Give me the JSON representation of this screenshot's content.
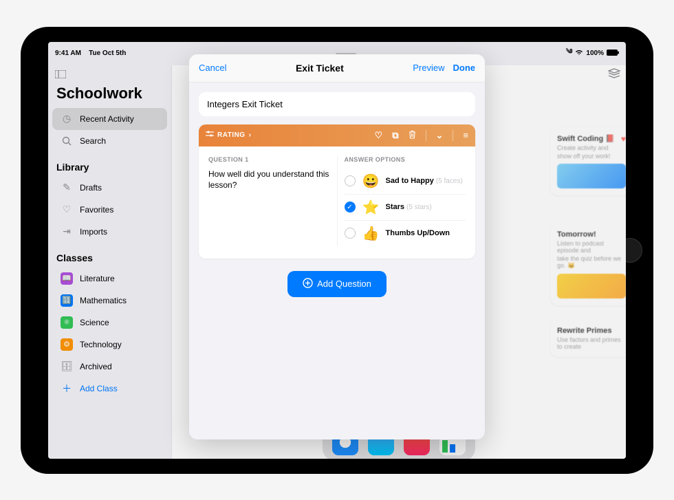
{
  "status": {
    "time": "9:41 AM",
    "date": "Tue Oct 5th",
    "battery": "100%"
  },
  "sidebar": {
    "appTitle": "Schoolwork",
    "recent": "Recent Activity",
    "search": "Search",
    "libraryHeader": "Library",
    "drafts": "Drafts",
    "favorites": "Favorites",
    "imports": "Imports",
    "classesHeader": "Classes",
    "literature": "Literature",
    "mathematics": "Mathematics",
    "science": "Science",
    "technology": "Technology",
    "archived": "Archived",
    "addClass": "Add Class"
  },
  "bgcards": {
    "c1title": "Swift Coding 📕",
    "c1sub1": "Create activity and",
    "c1sub2": "show off your work!",
    "c2title": "Tomorrow!",
    "c2sub1": "Listen to podcast episode and",
    "c2sub2": "take the quiz before we go. 🐱",
    "c3title": "Rewrite Primes",
    "c3sub": "Use factors and primes to create"
  },
  "modal": {
    "cancel": "Cancel",
    "title": "Exit Ticket",
    "preview": "Preview",
    "done": "Done",
    "assignmentTitle": "Integers Exit Ticket",
    "typeLabel": "RATING",
    "questionLabel": "QUESTION 1",
    "questionText": "How well did you understand this lesson?",
    "answerLabel": "ANSWER OPTIONS",
    "opt1": "Sad to Happy",
    "opt1sub": "(5 faces)",
    "opt2": "Stars",
    "opt2sub": "(5 stars)",
    "opt3": "Thumbs Up/Down",
    "addQuestion": "Add Question"
  }
}
